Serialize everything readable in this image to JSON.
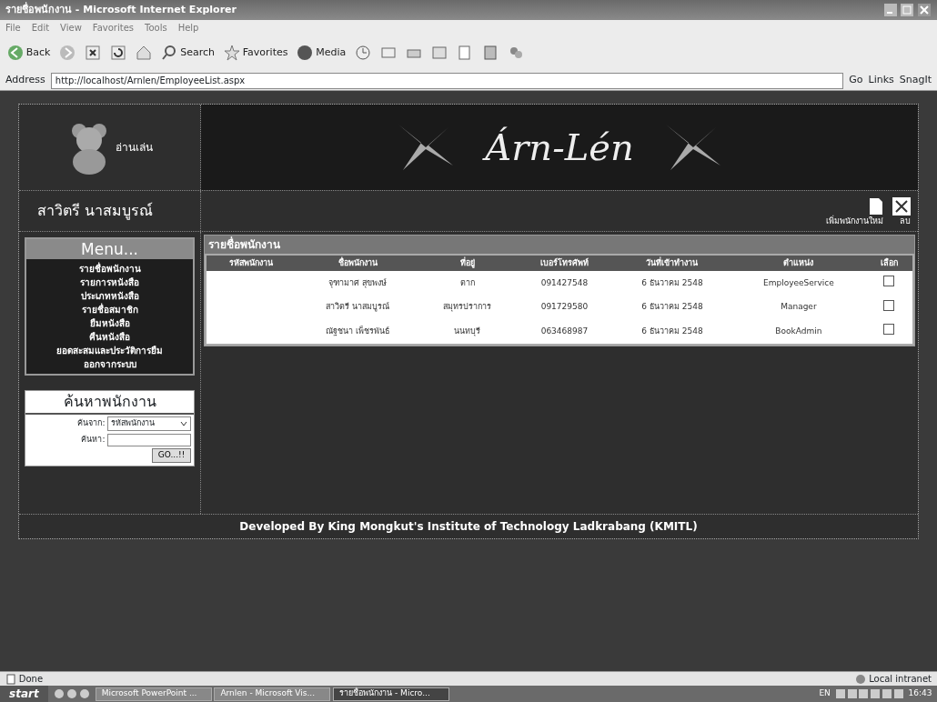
{
  "window": {
    "title": "รายชื่อพนักงาน - Microsoft Internet Explorer"
  },
  "menu_bar": [
    "File",
    "Edit",
    "View",
    "Favorites",
    "Tools",
    "Help"
  ],
  "toolbar": [
    {
      "kind": "back",
      "label": "Back"
    },
    {
      "kind": "forward"
    },
    {
      "kind": "stop"
    },
    {
      "kind": "refresh"
    },
    {
      "kind": "home"
    },
    {
      "kind": "search",
      "label": "Search"
    },
    {
      "kind": "favorites",
      "label": "Favorites"
    },
    {
      "kind": "media",
      "label": "Media"
    },
    {
      "kind": "history"
    },
    {
      "kind": "mail"
    },
    {
      "kind": "print"
    },
    {
      "kind": "edit"
    },
    {
      "kind": "discuss"
    },
    {
      "kind": "research"
    },
    {
      "kind": "messenger"
    }
  ],
  "address_bar": {
    "label": "Address",
    "url": "http://localhost/Arnlen/EmployeeList.aspx",
    "go": "Go",
    "links": "Links",
    "snagit": "SnagIt"
  },
  "page": {
    "logo_text": "อ่านเล่น",
    "banner_title": "Árn-Lén",
    "user_name": "สาวิตรี นาสมบูรณ์",
    "actions": [
      {
        "kind": "add",
        "label": "เพิ่มพนักงานใหม่"
      },
      {
        "kind": "delete",
        "label": "ลบ"
      }
    ],
    "menu": {
      "title": "Menu...",
      "items": [
        "รายชื่อพนักงาน",
        "รายการหนังสือ",
        "ประเภทหนังสือ",
        "รายชื่อสมาชิก",
        "ยืมหนังสือ",
        "คืนหนังสือ",
        "ยอดสะสมและประวัติการยืม",
        "ออกจากระบบ"
      ]
    },
    "search": {
      "title": "ค้นหาพนักงาน",
      "from_label": "ค้นจาก:",
      "from_value": "รหัสพนักงาน",
      "query_label": "ค้นหา:",
      "button": "GO...!!"
    },
    "table": {
      "title": "รายชื่อพนักงาน",
      "columns": [
        "รหัสพนักงาน",
        "ชื่อพนักงาน",
        "ที่อยู่",
        "เบอร์โทรศัพท์",
        "วันที่เข้าทำงาน",
        "ตำแหน่ง",
        "เลือก"
      ],
      "rows": [
        {
          "name": "จุฑามาศ สุขพงษ์",
          "address": "ตาก",
          "phone": "091427548",
          "start_date": "6 ธันวาคม 2548",
          "position": "EmployeeService",
          "checked": false
        },
        {
          "name": "สาวิตรี นาสมบูรณ์",
          "address": "สมุทรปราการ",
          "phone": "091729580",
          "start_date": "6 ธันวาคม 2548",
          "position": "Manager",
          "checked": false
        },
        {
          "name": "ณัฐชนา เพ็ชรพันธ์",
          "address": "นนทบุรี",
          "phone": "063468987",
          "start_date": "6 ธันวาคม 2548",
          "position": "BookAdmin",
          "checked": false
        }
      ]
    },
    "footer": "Developed By King Mongkut's Institute of Technology Ladkrabang (KMITL)"
  },
  "status_bar": {
    "text": "Done",
    "zone": "Local intranet"
  },
  "taskbar": {
    "start": "start",
    "tasks": [
      {
        "label": "Microsoft PowerPoint ...",
        "selected": false
      },
      {
        "label": "Arnlen - Microsoft Vis...",
        "selected": false
      },
      {
        "label": "รายชื่อพนักงาน - Micro...",
        "selected": true
      }
    ],
    "language": "EN",
    "clock": "16:43"
  }
}
